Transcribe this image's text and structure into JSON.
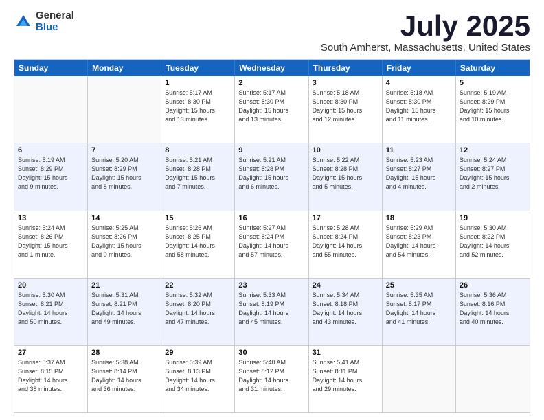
{
  "logo": {
    "general": "General",
    "blue": "Blue"
  },
  "title": {
    "month": "July 2025",
    "location": "South Amherst, Massachusetts, United States"
  },
  "headers": [
    "Sunday",
    "Monday",
    "Tuesday",
    "Wednesday",
    "Thursday",
    "Friday",
    "Saturday"
  ],
  "rows": [
    [
      {
        "day": "",
        "info": ""
      },
      {
        "day": "",
        "info": ""
      },
      {
        "day": "1",
        "info": "Sunrise: 5:17 AM\nSunset: 8:30 PM\nDaylight: 15 hours\nand 13 minutes."
      },
      {
        "day": "2",
        "info": "Sunrise: 5:17 AM\nSunset: 8:30 PM\nDaylight: 15 hours\nand 13 minutes."
      },
      {
        "day": "3",
        "info": "Sunrise: 5:18 AM\nSunset: 8:30 PM\nDaylight: 15 hours\nand 12 minutes."
      },
      {
        "day": "4",
        "info": "Sunrise: 5:18 AM\nSunset: 8:30 PM\nDaylight: 15 hours\nand 11 minutes."
      },
      {
        "day": "5",
        "info": "Sunrise: 5:19 AM\nSunset: 8:29 PM\nDaylight: 15 hours\nand 10 minutes."
      }
    ],
    [
      {
        "day": "6",
        "info": "Sunrise: 5:19 AM\nSunset: 8:29 PM\nDaylight: 15 hours\nand 9 minutes."
      },
      {
        "day": "7",
        "info": "Sunrise: 5:20 AM\nSunset: 8:29 PM\nDaylight: 15 hours\nand 8 minutes."
      },
      {
        "day": "8",
        "info": "Sunrise: 5:21 AM\nSunset: 8:28 PM\nDaylight: 15 hours\nand 7 minutes."
      },
      {
        "day": "9",
        "info": "Sunrise: 5:21 AM\nSunset: 8:28 PM\nDaylight: 15 hours\nand 6 minutes."
      },
      {
        "day": "10",
        "info": "Sunrise: 5:22 AM\nSunset: 8:28 PM\nDaylight: 15 hours\nand 5 minutes."
      },
      {
        "day": "11",
        "info": "Sunrise: 5:23 AM\nSunset: 8:27 PM\nDaylight: 15 hours\nand 4 minutes."
      },
      {
        "day": "12",
        "info": "Sunrise: 5:24 AM\nSunset: 8:27 PM\nDaylight: 15 hours\nand 2 minutes."
      }
    ],
    [
      {
        "day": "13",
        "info": "Sunrise: 5:24 AM\nSunset: 8:26 PM\nDaylight: 15 hours\nand 1 minute."
      },
      {
        "day": "14",
        "info": "Sunrise: 5:25 AM\nSunset: 8:26 PM\nDaylight: 15 hours\nand 0 minutes."
      },
      {
        "day": "15",
        "info": "Sunrise: 5:26 AM\nSunset: 8:25 PM\nDaylight: 14 hours\nand 58 minutes."
      },
      {
        "day": "16",
        "info": "Sunrise: 5:27 AM\nSunset: 8:24 PM\nDaylight: 14 hours\nand 57 minutes."
      },
      {
        "day": "17",
        "info": "Sunrise: 5:28 AM\nSunset: 8:24 PM\nDaylight: 14 hours\nand 55 minutes."
      },
      {
        "day": "18",
        "info": "Sunrise: 5:29 AM\nSunset: 8:23 PM\nDaylight: 14 hours\nand 54 minutes."
      },
      {
        "day": "19",
        "info": "Sunrise: 5:30 AM\nSunset: 8:22 PM\nDaylight: 14 hours\nand 52 minutes."
      }
    ],
    [
      {
        "day": "20",
        "info": "Sunrise: 5:30 AM\nSunset: 8:21 PM\nDaylight: 14 hours\nand 50 minutes."
      },
      {
        "day": "21",
        "info": "Sunrise: 5:31 AM\nSunset: 8:21 PM\nDaylight: 14 hours\nand 49 minutes."
      },
      {
        "day": "22",
        "info": "Sunrise: 5:32 AM\nSunset: 8:20 PM\nDaylight: 14 hours\nand 47 minutes."
      },
      {
        "day": "23",
        "info": "Sunrise: 5:33 AM\nSunset: 8:19 PM\nDaylight: 14 hours\nand 45 minutes."
      },
      {
        "day": "24",
        "info": "Sunrise: 5:34 AM\nSunset: 8:18 PM\nDaylight: 14 hours\nand 43 minutes."
      },
      {
        "day": "25",
        "info": "Sunrise: 5:35 AM\nSunset: 8:17 PM\nDaylight: 14 hours\nand 41 minutes."
      },
      {
        "day": "26",
        "info": "Sunrise: 5:36 AM\nSunset: 8:16 PM\nDaylight: 14 hours\nand 40 minutes."
      }
    ],
    [
      {
        "day": "27",
        "info": "Sunrise: 5:37 AM\nSunset: 8:15 PM\nDaylight: 14 hours\nand 38 minutes."
      },
      {
        "day": "28",
        "info": "Sunrise: 5:38 AM\nSunset: 8:14 PM\nDaylight: 14 hours\nand 36 minutes."
      },
      {
        "day": "29",
        "info": "Sunrise: 5:39 AM\nSunset: 8:13 PM\nDaylight: 14 hours\nand 34 minutes."
      },
      {
        "day": "30",
        "info": "Sunrise: 5:40 AM\nSunset: 8:12 PM\nDaylight: 14 hours\nand 31 minutes."
      },
      {
        "day": "31",
        "info": "Sunrise: 5:41 AM\nSunset: 8:11 PM\nDaylight: 14 hours\nand 29 minutes."
      },
      {
        "day": "",
        "info": ""
      },
      {
        "day": "",
        "info": ""
      }
    ]
  ]
}
